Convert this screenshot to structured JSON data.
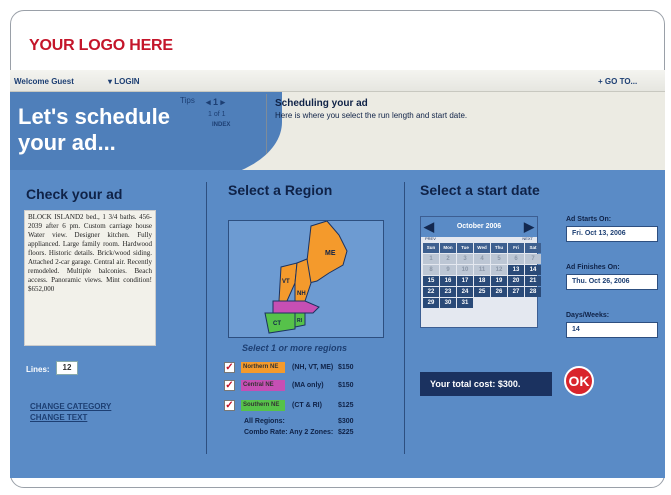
{
  "logo": {
    "text": "YOUR LOGO HERE"
  },
  "topbar": {
    "welcome": "Welcome Guest",
    "login": "LOGIN",
    "goto": "GO TO..."
  },
  "hero": {
    "title": "Let's schedule your ad..."
  },
  "tips": {
    "label": "Tips",
    "nav": "◂ 1 ▸",
    "pager": "1 of 1",
    "index": "INDEX",
    "title": "Scheduling your ad",
    "text": "Here is where you select the run length and start date."
  },
  "check_ad": {
    "title": "Check your ad",
    "ad_text": "BLOCK ISLAND2 bed., 1 3/4 baths. 456-2039 after 6 pm. Custom carriage house Water view. Designer kitchen. Fully applianced. Large family room. Hardwood floors. Historic details. Brick/wood siding. Attached 2-car garage. Central air. Recently remodeled. Multiple balconies. Beach access. Panoramic views. Mint condition! $652,000",
    "lines_label": "Lines:",
    "lines_value": "12",
    "change_category": "CHANGE CATEGORY",
    "change_text": "CHANGE TEXT"
  },
  "region": {
    "title": "Select a Region",
    "map_labels": {
      "me": "ME",
      "vt": "VT",
      "nh": "NH",
      "ct": "CT",
      "ri": "RI"
    },
    "hint": "Select 1 or more regions",
    "rows": [
      {
        "name": "Northern NE",
        "scope": "(NH, VT, ME)",
        "price": "$150",
        "color": "#f49a2c",
        "checked": "✓"
      },
      {
        "name": "Central NE",
        "scope": "(MA only)",
        "price": "$150",
        "color": "#c64fb4",
        "checked": "✓"
      },
      {
        "name": "Southern NE",
        "scope": "(CT & RI)",
        "price": "$125",
        "color": "#56c24a",
        "checked": "✓"
      }
    ],
    "all_label": "All Regions:",
    "all_price": "$300",
    "combo_label": "Combo Rate: Any 2 Zones:",
    "combo_price": "$225"
  },
  "date": {
    "title": "Select a start date",
    "month": "October 2006",
    "prev": "PREV",
    "next": "NEXT",
    "weekdays": [
      "Sun",
      "Mon",
      "Tue",
      "Wed",
      "Thu",
      "Fri",
      "Sat"
    ],
    "days": [
      "1",
      "2",
      "3",
      "4",
      "5",
      "6",
      "7",
      "8",
      "9",
      "10",
      "11",
      "12",
      "13",
      "14",
      "15",
      "16",
      "17",
      "18",
      "19",
      "20",
      "21",
      "22",
      "23",
      "24",
      "25",
      "26",
      "27",
      "28",
      "29",
      "30",
      "31"
    ],
    "selectable_from": 13,
    "starts_label": "Ad Starts On:",
    "starts_value": "Fri. Oct 13, 2006",
    "finishes_label": "Ad Finishes On:",
    "finishes_value": "Thu. Oct 26, 2006",
    "days_label": "Days/Weeks:",
    "days_value": "14"
  },
  "total": {
    "label": "Your total cost:",
    "value": "$300."
  },
  "ok": {
    "label": "OK"
  },
  "colors": {
    "accent": "#c4152a",
    "panel": "#5a8bc6",
    "dark": "#1b3260"
  }
}
